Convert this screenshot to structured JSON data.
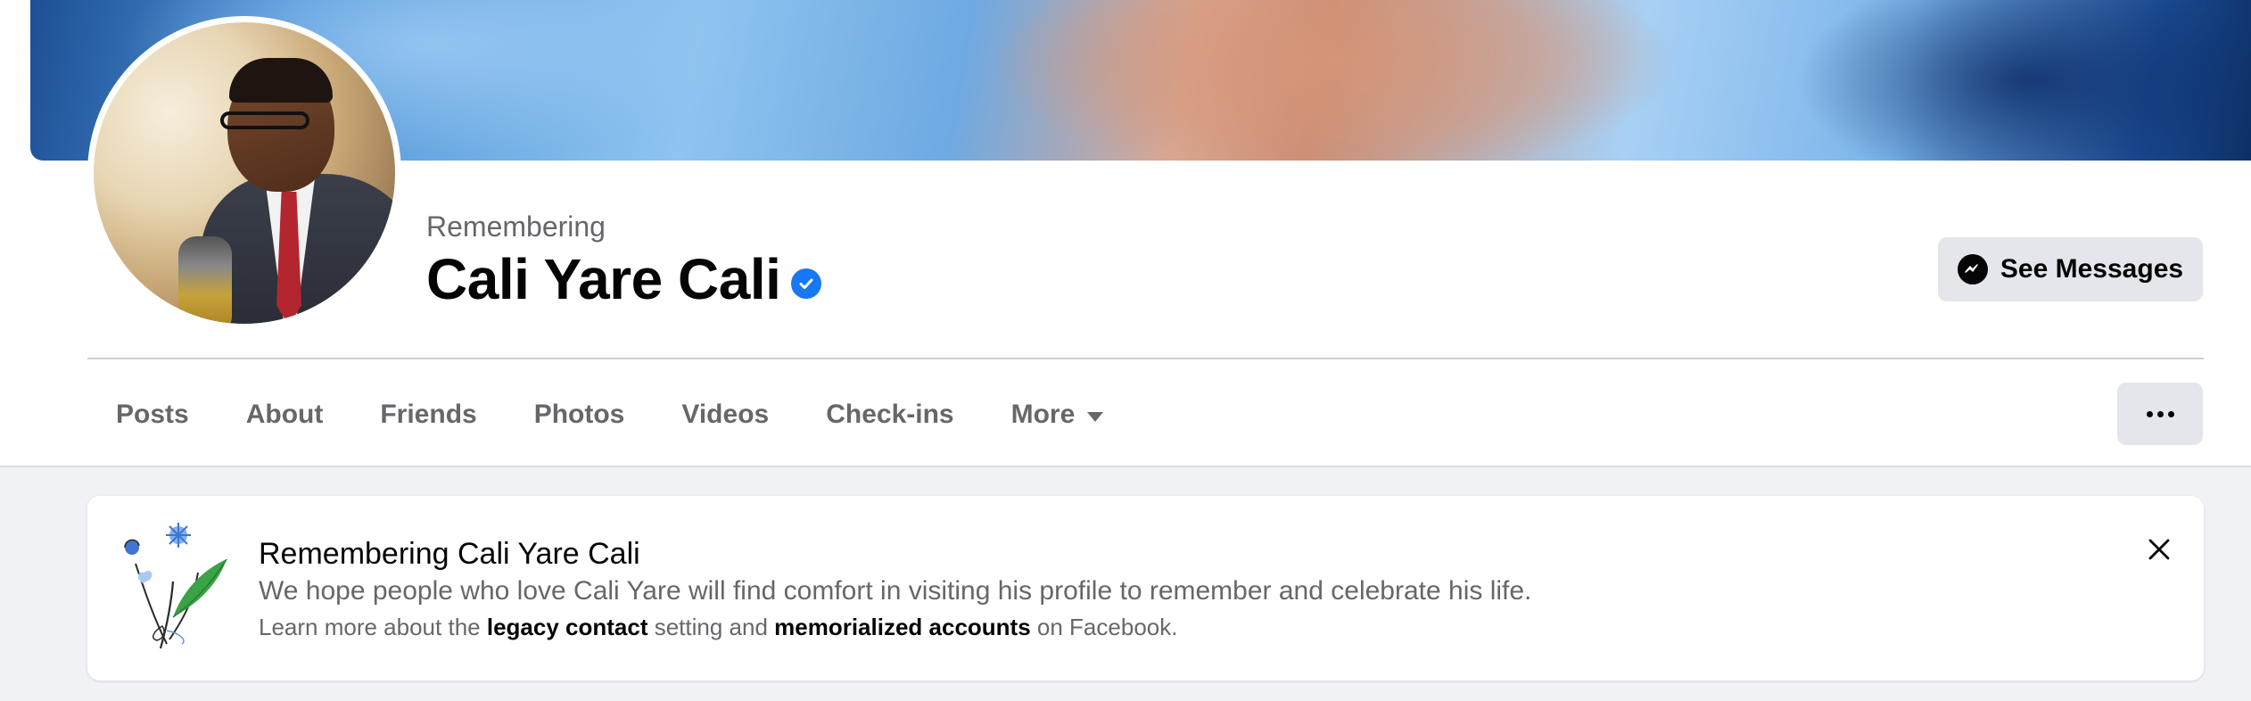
{
  "profile": {
    "remembering_label": "Remembering",
    "name": "Cali Yare Cali",
    "verified_badge": "verified-icon"
  },
  "actions": {
    "see_messages": "See Messages",
    "more_options": "more-options-icon"
  },
  "tabs": [
    {
      "label": "Posts"
    },
    {
      "label": "About"
    },
    {
      "label": "Friends"
    },
    {
      "label": "Photos"
    },
    {
      "label": "Videos"
    },
    {
      "label": "Check-ins"
    },
    {
      "label": "More"
    }
  ],
  "memorial_card": {
    "title": "Remembering Cali Yare Cali",
    "description": "We hope people who love Cali Yare will find comfort in visiting his profile to remember and celebrate his life.",
    "learn_prefix": "Learn more about the ",
    "legacy_contact": "legacy contact",
    "learn_middle": " setting and ",
    "memorialized_accounts": "memorialized accounts",
    "learn_suffix": " on Facebook."
  },
  "colors": {
    "accent_blue": "#1877f2",
    "secondary_text": "#65676b",
    "button_bg": "#e4e6eb",
    "page_bg": "#f0f2f5"
  }
}
